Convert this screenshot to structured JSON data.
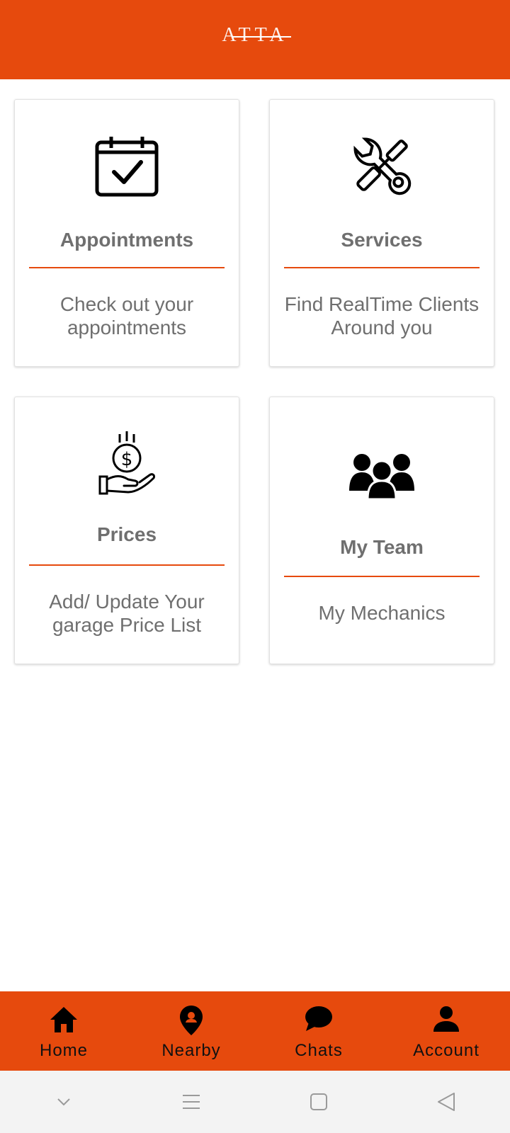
{
  "app": {
    "logo_text": "ATTA",
    "brand_color": "#E64A0D"
  },
  "cards": [
    {
      "icon": "calendar-check-icon",
      "title": "Appointments",
      "description_lines": [
        "Check out your",
        "appointments"
      ]
    },
    {
      "icon": "tools-icon",
      "title": "Services",
      "description_lines": [
        "Find RealTime Clients",
        "Around you"
      ]
    },
    {
      "icon": "hand-money-icon",
      "title": "Prices",
      "description_lines": [
        "Add/ Update Your",
        "garage Price List"
      ]
    },
    {
      "icon": "team-icon",
      "title": "My Team",
      "description_lines": [
        "My Mechanics"
      ]
    }
  ],
  "bottom_nav": [
    {
      "icon": "home-icon",
      "label": "Home"
    },
    {
      "icon": "location-pin-icon",
      "label": "Nearby"
    },
    {
      "icon": "chat-bubble-icon",
      "label": "Chats"
    },
    {
      "icon": "person-icon",
      "label": "Account"
    }
  ],
  "system_nav": [
    {
      "icon": "chevron-down-icon"
    },
    {
      "icon": "menu-icon"
    },
    {
      "icon": "square-home-icon"
    },
    {
      "icon": "back-triangle-icon"
    }
  ]
}
